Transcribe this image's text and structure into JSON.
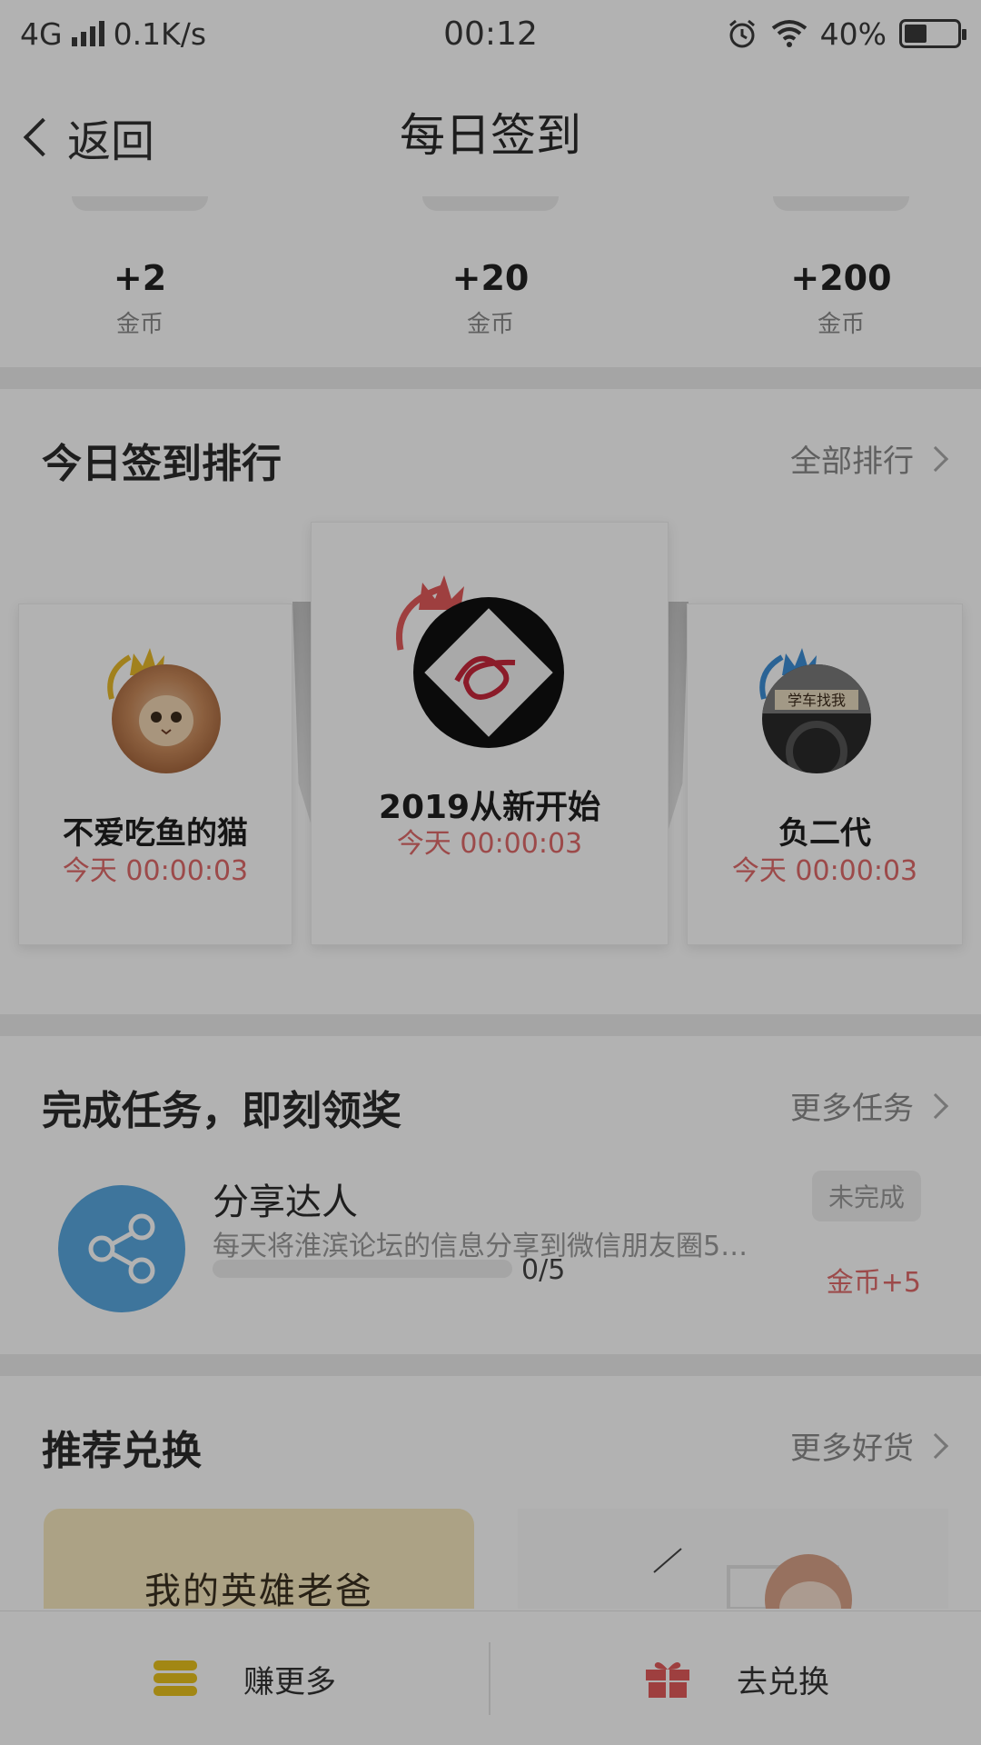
{
  "status_bar": {
    "network": "4G",
    "speed": "0.1K/s",
    "time": "00:12",
    "battery": "40%"
  },
  "nav": {
    "back_label": "返回",
    "title": "每日签到"
  },
  "rewards": [
    {
      "amount": "+2",
      "unit": "金币"
    },
    {
      "amount": "+20",
      "unit": "金币"
    },
    {
      "amount": "+200",
      "unit": "金币"
    }
  ],
  "ranking": {
    "title": "今日签到排行",
    "more_label": "全部排行",
    "entries": [
      {
        "name": "不爱吃鱼的猫",
        "time": "今天 00:00:03",
        "crown_color": "#e7b92a"
      },
      {
        "name": "2019从新开始",
        "time": "今天 00:00:03",
        "crown_color": "#e35b5b"
      },
      {
        "name": "负二代",
        "time": "今天 00:00:03",
        "crown_color": "#3d8fd6"
      }
    ],
    "avatar_text": {
      "second": "学车找我"
    }
  },
  "tasks": {
    "title": "完成任务，即刻领奖",
    "more_label": "更多任务",
    "items": [
      {
        "name": "分享达人",
        "desc": "每天将淮滨论坛的信息分享到微信朋友圈5…",
        "progress_text": "0/5",
        "progress": 0,
        "status": "未完成",
        "reward": "金币+5"
      }
    ]
  },
  "exchange": {
    "title": "推荐兑换",
    "more_label": "更多好货",
    "card1_text": "我的英雄老爸"
  },
  "bottom_bar": {
    "earn_label": "赚更多",
    "redeem_label": "去兑换"
  },
  "colors": {
    "accent_red": "#e06a6a",
    "coin_gold": "#e8c21e",
    "share_blue": "#5aa8e0"
  }
}
